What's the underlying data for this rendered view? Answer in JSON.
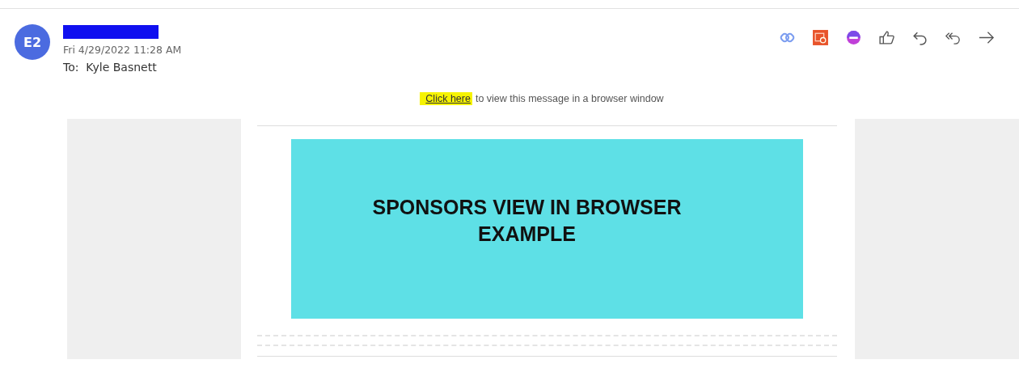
{
  "message": {
    "avatar": "E2",
    "sender_redacted": true,
    "date": "Fri 4/29/2022 11:28 AM",
    "to_label": "To:",
    "to": "Kyle Basnett"
  },
  "toolbar": [
    {
      "kind": "loop"
    },
    {
      "kind": "calendar"
    },
    {
      "kind": "circle"
    },
    {
      "kind": "like"
    },
    {
      "kind": "reply"
    },
    {
      "kind": "reply-all"
    },
    {
      "kind": "forward"
    }
  ],
  "browser_link": {
    "link": "Click here",
    "text": "to view this message in a browser window"
  },
  "banner": {
    "title": "SPONSORS VIEW IN BROWSER EXAMPLE"
  }
}
